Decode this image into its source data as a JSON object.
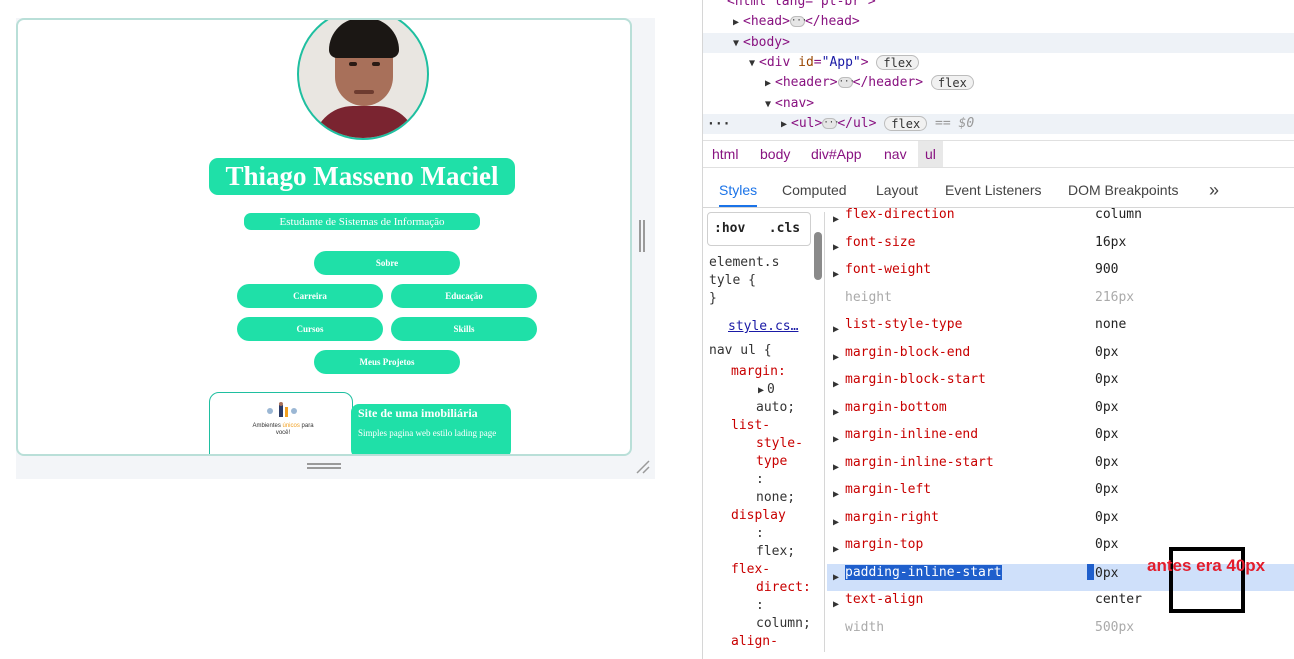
{
  "viewport": {
    "profile_name": "Thiago Masseno Maciel",
    "profile_subtitle": "Estudante de Sistemas de Informação",
    "nav_buttons": [
      "Sobre",
      "Carreira",
      "Educação",
      "Cursos",
      "Skills",
      "Meus Projetos"
    ],
    "project": {
      "thumb_text_a": "Ambientes",
      "thumb_text_b": "únicos",
      "thumb_text_c": "para você!",
      "title": "Site de uma imobiliária",
      "description": "Simples pagina web estilo lading page"
    },
    "accent_color": "#1fe0a8"
  },
  "devtools": {
    "dom": {
      "html_tag": "<html lang=\"pt-br\">",
      "head_open": "<head>",
      "head_close": "</head>",
      "body_open": "<body>",
      "div_tag": "<div",
      "div_attr": "id",
      "div_val": "\"App\"",
      "div_end": ">",
      "header_open": "<header>",
      "header_close": "</header>",
      "nav_open": "<nav>",
      "ul_open": "<ul>",
      "ul_close": "</ul>",
      "flex_badge": "flex",
      "selected_marker": "== $0",
      "ellipsis": "···"
    },
    "breadcrumbs": [
      "html",
      "body",
      "div#App",
      "nav",
      "ul"
    ],
    "tabs": [
      "Styles",
      "Computed",
      "Layout",
      "Event Listeners",
      "DOM Breakpoints"
    ],
    "more_tabs_icon": "»",
    "filter": {
      "hov": ":hov",
      "cls": ".cls"
    },
    "styles_pane": {
      "element_style_1": "element.s",
      "element_style_2": "tyle {",
      "element_style_3": "}",
      "source_link": "style.cs…",
      "selector": "nav ul {",
      "lines": [
        "margin:",
        "0",
        "auto;",
        "list-",
        "style-",
        "type",
        ":",
        "none;",
        "display",
        ":",
        "flex;",
        "flex-",
        "direct:",
        ":",
        "column;",
        "align-"
      ]
    },
    "computed": [
      {
        "name": "flex-direction",
        "value": "column",
        "inherited": false
      },
      {
        "name": "font-size",
        "value": "16px",
        "inherited": false
      },
      {
        "name": "font-weight",
        "value": "900",
        "inherited": false
      },
      {
        "name": "height",
        "value": "216px",
        "inherited": true
      },
      {
        "name": "list-style-type",
        "value": "none",
        "inherited": false
      },
      {
        "name": "margin-block-end",
        "value": "0px",
        "inherited": false
      },
      {
        "name": "margin-block-start",
        "value": "0px",
        "inherited": false
      },
      {
        "name": "margin-bottom",
        "value": "0px",
        "inherited": false
      },
      {
        "name": "margin-inline-end",
        "value": "0px",
        "inherited": false
      },
      {
        "name": "margin-inline-start",
        "value": "0px",
        "inherited": false
      },
      {
        "name": "margin-left",
        "value": "0px",
        "inherited": false
      },
      {
        "name": "margin-right",
        "value": "0px",
        "inherited": false
      },
      {
        "name": "margin-top",
        "value": "0px",
        "inherited": false
      },
      {
        "name": "padding-inline-start",
        "value": "0px",
        "inherited": false,
        "selected": true
      },
      {
        "name": "text-align",
        "value": "center",
        "inherited": false
      },
      {
        "name": "width",
        "value": "500px",
        "inherited": true
      }
    ],
    "annotation": "antes era 40px"
  }
}
